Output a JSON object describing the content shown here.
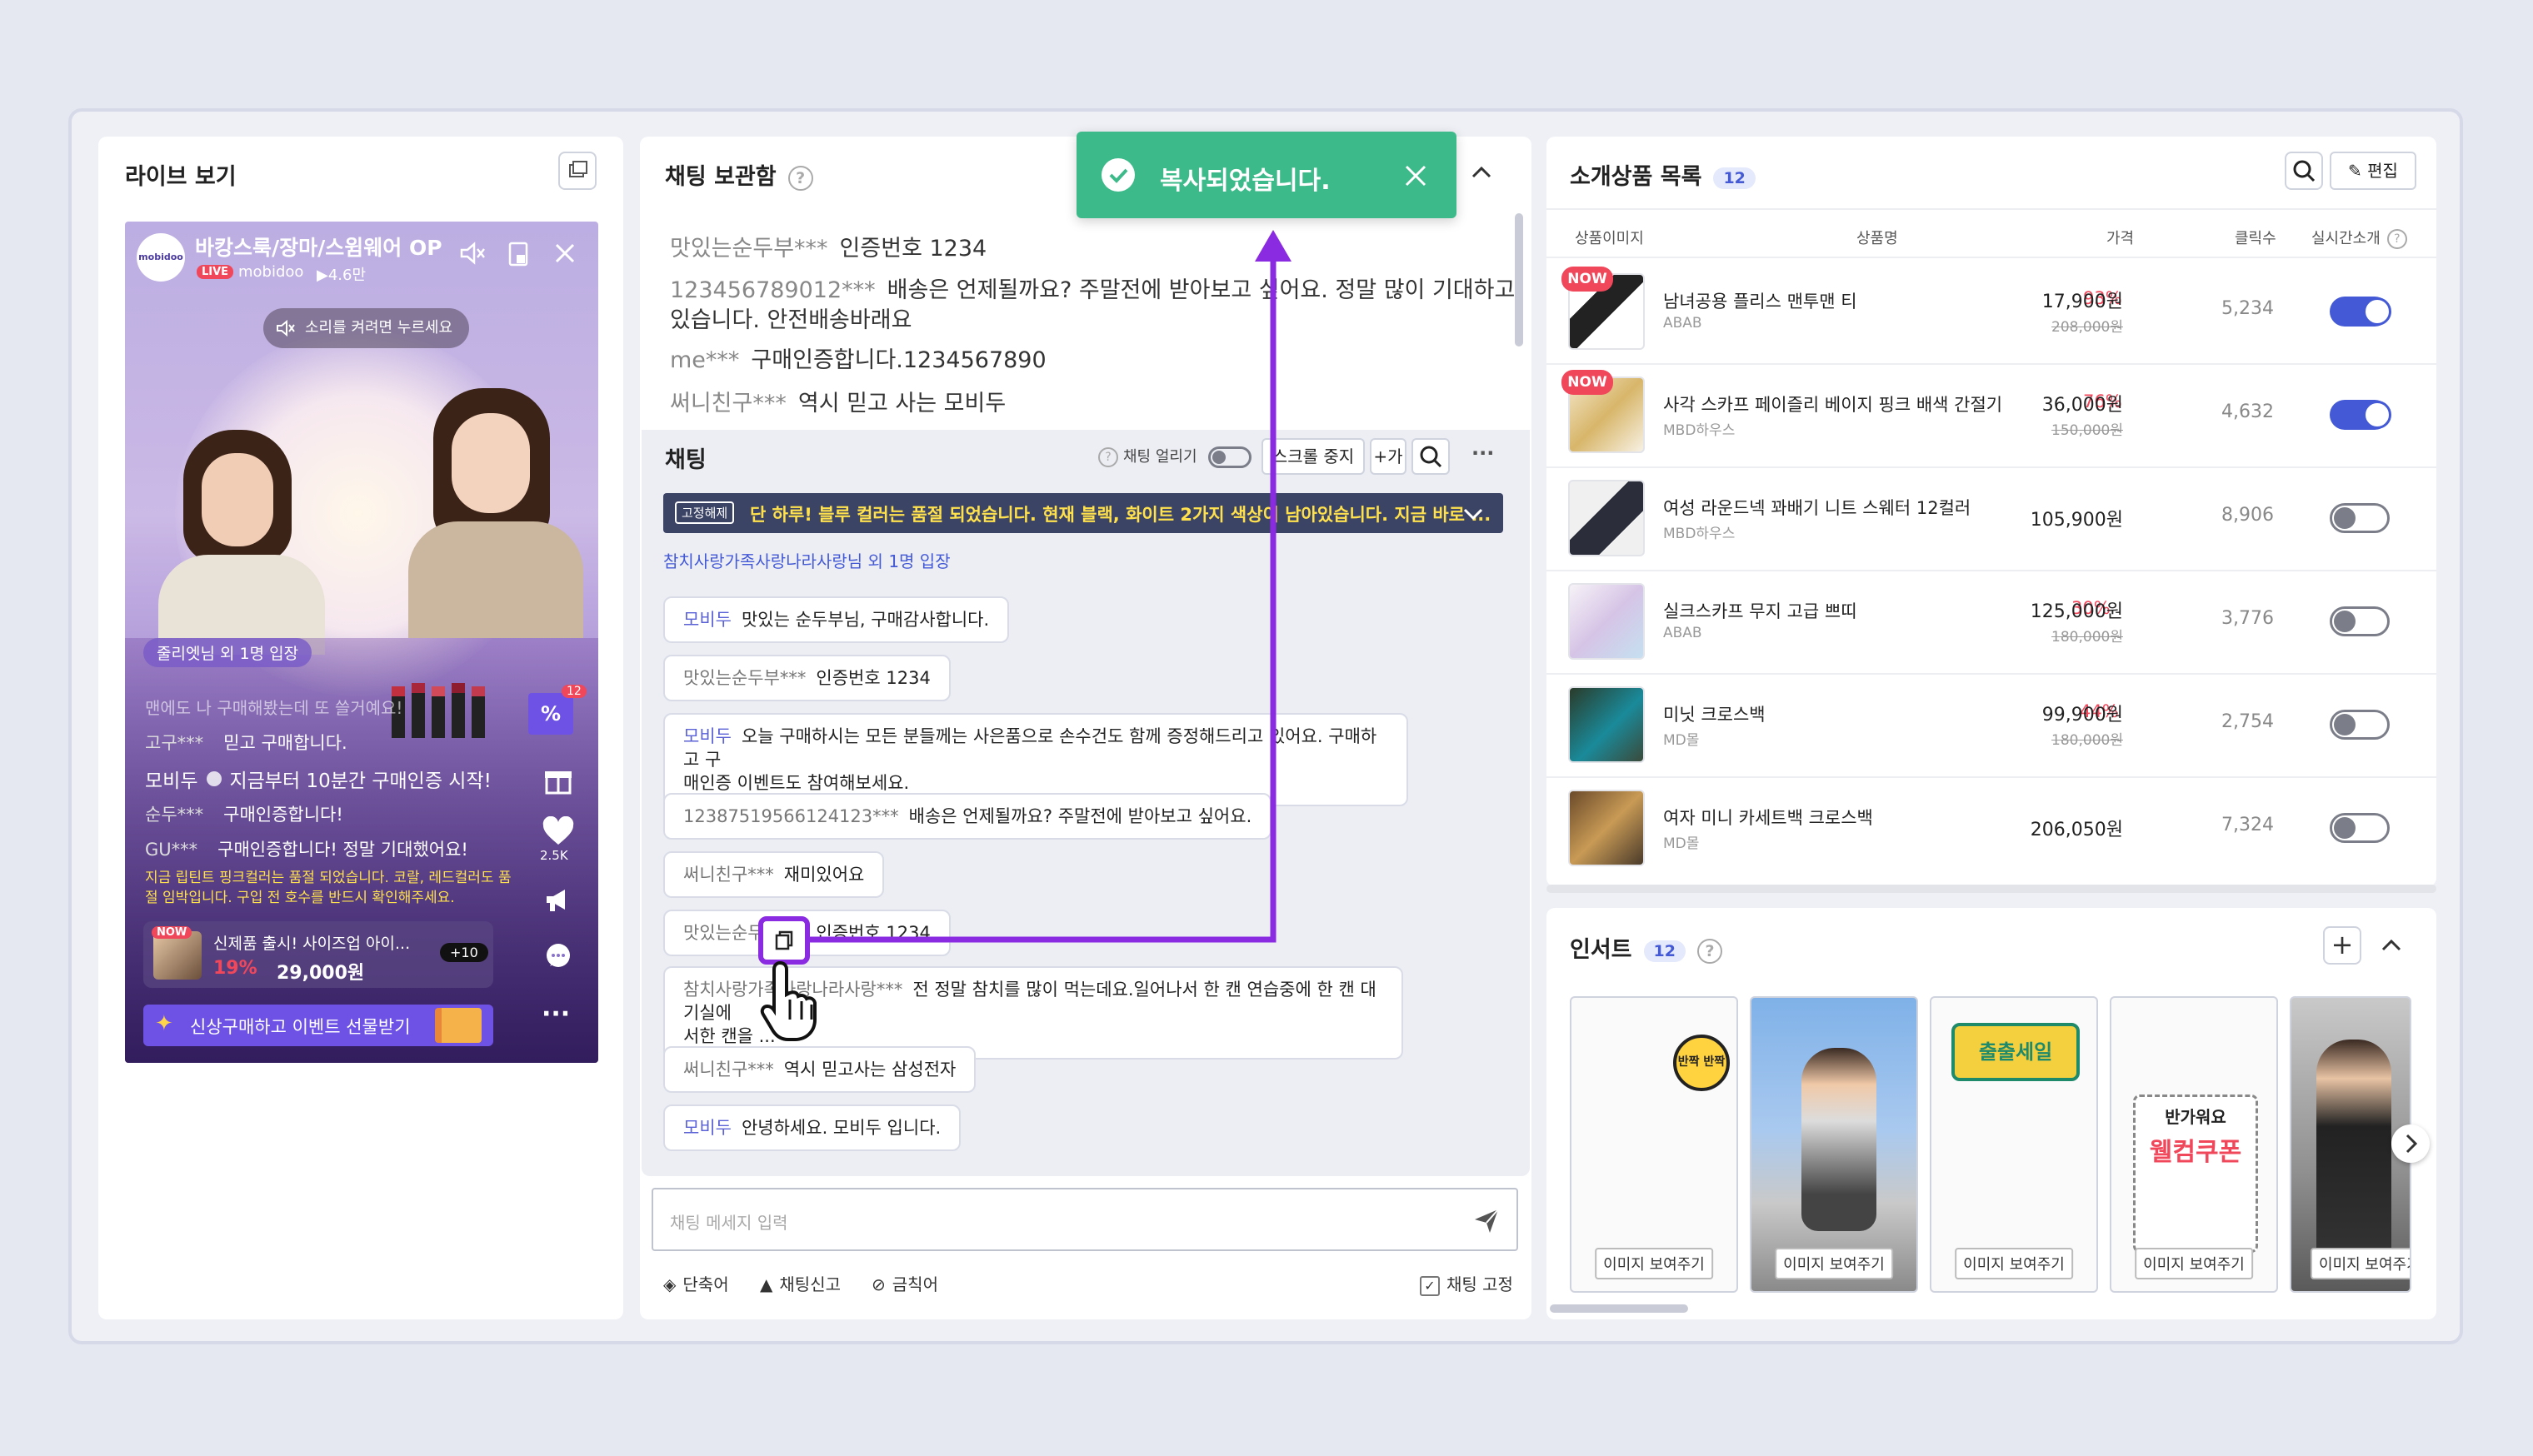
{
  "live": {
    "title": "라이브 보기",
    "channel_title": "바캉스룩/장마/스윔웨어 OP",
    "channel_name": "mobidoo",
    "live_badge": "LIVE",
    "views": "▶4.6만",
    "logo_text": "mobidoo",
    "sound_hint": "소리를 켜려면 누르세요",
    "entry_notice": "줄리엣님 외 1명 입장",
    "messages": [
      {
        "user": "맨에도 나 구매해봤는데 또 쓸거예요!",
        "text": ""
      },
      {
        "user": "고구***",
        "text": "믿고 구매합니다."
      },
      {
        "user": "모비두",
        "text": "지금부터 10분간 구매인증 시작!"
      },
      {
        "user": "순두***",
        "text": "구매인증합니다!"
      },
      {
        "user": "GU***",
        "text": "구매인증합니다! 정말 기대했어요!"
      }
    ],
    "yellow_notice": "지금 립틴트 핑크컬러는 품절 되었습니다. 코랄, 레드컬러도 품절 임박입니다. 구입 전 호수를 반드시 확인해주세요.",
    "product_now": "NOW",
    "product_name": "신제품 출시! 사이즈업 아이...",
    "product_discount": "19%",
    "product_price": "29,000원",
    "product_more": "+10",
    "event_banner": "신상구매하고 이벤트 선물받기",
    "percent_badge": "%",
    "percent_count": "12",
    "like_count": "2.5K",
    "more_dots": "···"
  },
  "toast": {
    "message": "복사되었습니다.",
    "color": "#3dba8a"
  },
  "chat_archive": {
    "title": "채팅 보관함",
    "messages": [
      {
        "user": "맛있는순두부***",
        "text": "인증번호 1234"
      },
      {
        "user": "123456789012***",
        "text": "배송은 언제될까요? 주말전에 받아보고 싶어요. 정말 많이 기대하고"
      },
      {
        "user": "",
        "text": "있습니다. 안전배송바래요"
      },
      {
        "user": "me***",
        "text": "구매인증합니다.1234567890"
      },
      {
        "user": "써니친구***",
        "text": "역시 믿고 사는 모비두"
      }
    ]
  },
  "chat": {
    "title": "채팅",
    "freeze_label": "채팅 얼리기",
    "scroll_stop": "스크롤 중지",
    "font_plus": "+가",
    "more": "···",
    "pinned_tag": "고정해제",
    "pinned_text": "단 하루! 블루 컬러는 품절 되었습니다. 현재 블랙, 화이트 2가지 색상이 남아있습니다. 지금 바로 ...",
    "entry_text": "참치사랑가족사랑나라사랑님 외 1명 입장",
    "messages": [
      {
        "user": "모비두",
        "text": "맛있는 순두부님, 구매감사합니다.",
        "host": true
      },
      {
        "user": "맛있는순두부***",
        "text": "인증번호 1234",
        "host": false
      },
      {
        "user": "모비두",
        "text": "오늘 구매하시는 모든 분들께는 사은품으로 손수건도 함께 증정해드리고 있어요. 구매하고 구",
        "text2": "매인증 이벤트도 참여해보세요.",
        "host": true
      },
      {
        "user": "12387519566124123***",
        "text": "배송은 언제될까요? 주말전에 받아보고 싶어요.",
        "host": false
      },
      {
        "user": "써니친구***",
        "text": "재미있어요",
        "host": false
      },
      {
        "user": "맛있는순두부***",
        "text": "인증번호 1234",
        "host": false
      },
      {
        "user": "참치사랑가족사랑나라사랑***",
        "text": "전 정말 참치를 많이 먹는데요.일어나서 한 캔 연습중에 한 캔 대기실에",
        "text2": "서한 캔을 ...",
        "host": false
      },
      {
        "user": "써니친구***",
        "text": "역시 믿고사는 삼성전자",
        "host": false
      },
      {
        "user": "모비두",
        "text": "안녕하세요. 모비두 입니다.",
        "host": true
      }
    ],
    "input_placeholder": "채팅 메세지 입력",
    "shortcut": "단축어",
    "report": "채팅신고",
    "banned": "금칙어",
    "pin_chat": "채팅 고정"
  },
  "products": {
    "title": "소개상품 목록",
    "count": "12",
    "edit": "편집",
    "headers": {
      "image": "상품이미지",
      "name": "상품명",
      "price": "가격",
      "clicks": "클릭수",
      "live": "실시간소개"
    },
    "items": [
      {
        "now": true,
        "name": "남녀공용 플리스 맨투맨 티",
        "brand": "ABAB",
        "discount": "93%",
        "price": "17,900원",
        "original": "208,000원",
        "clicks": "5,234",
        "on": true
      },
      {
        "now": true,
        "name": "사각 스카프 페이즐리 베이지 핑크 배색 간절기",
        "brand": "MBD하우스",
        "discount": "76%",
        "price": "36,000원",
        "original": "150,000원",
        "clicks": "4,632",
        "on": true
      },
      {
        "now": false,
        "name": "여성 라운드넥 꽈배기 니트 스웨터 12컬러",
        "brand": "MBD하우스",
        "discount": "",
        "price": "105,900원",
        "original": "",
        "clicks": "8,906",
        "on": false
      },
      {
        "now": false,
        "name": "실크스카프 무지 고급 쁘띠",
        "brand": "ABAB",
        "discount": "30%",
        "price": "125,000원",
        "original": "180,000원",
        "clicks": "3,776",
        "on": false
      },
      {
        "now": false,
        "name": "미닛 크로스백",
        "brand": "MD몰",
        "discount": "44%",
        "price": "99,900원",
        "original": "180,000원",
        "clicks": "2,754",
        "on": false
      },
      {
        "now": false,
        "name": "여자 미니 카세트백 크로스백",
        "brand": "MD몰",
        "discount": "",
        "price": "206,050원",
        "original": "",
        "clicks": "7,324",
        "on": false
      }
    ],
    "now_label": "NOW"
  },
  "insert": {
    "title": "인서트",
    "count": "12",
    "card_label": "이미지 보여주기",
    "cards": [
      "반짝반짝",
      "photo-model-1",
      "출출세일",
      "웰컴쿠폰",
      "photo-model-2"
    ],
    "card_texts": {
      "sparkle": "반짝 반짝",
      "sale": "출출세일",
      "welcome_top": "반가워요",
      "welcome_main": "웰컴쿠폰"
    }
  }
}
